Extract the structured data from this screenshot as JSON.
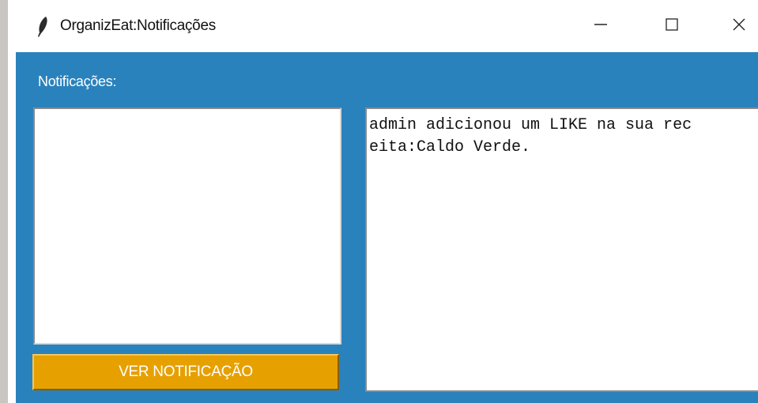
{
  "window": {
    "title": "OrganizEat:Notificações",
    "icon": "feather-icon",
    "controls": {
      "minimize": "minimize-icon",
      "maximize": "maximize-icon",
      "close": "close-icon"
    }
  },
  "main": {
    "section_label": "Notificações:",
    "notifications_list": [],
    "view_button_label": "VER NOTIFICAÇÃO",
    "message_lines": [
      "admin adicionou um LIKE na sua rec",
      "eita:Caldo Verde."
    ]
  },
  "colors": {
    "background": "#2a82bd",
    "button": "#e6a000",
    "titlebar": "#ffffff"
  }
}
